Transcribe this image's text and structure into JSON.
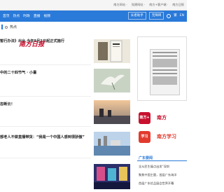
{
  "topbar": {
    "links": [
      "南方网站 ·",
      "党建网站 ·",
      "南方+客户端 ·",
      "南方日报"
    ]
  },
  "navbar": {
    "items": [
      "首页",
      "热点",
      "时政",
      "直播",
      "视频"
    ],
    "buttons": [
      "长者助手",
      "无障碍"
    ],
    "lang": [
      "繁",
      "EN"
    ]
  },
  "section": {
    "title": "热点"
  },
  "news": [
    {
      "title": "暂行办法》出台 今年9月1日起正式施行"
    },
    {
      "title": "中的二十四节气 · 小暑"
    },
    {
      "title": "忽断云！"
    },
    {
      "title": "部老人不做直播带货：“我是一个中国人感到很骄傲”"
    },
    {
      "title": ""
    }
  ],
  "side": {
    "logo": "南方日报",
    "apps": [
      {
        "icon": "南方+",
        "label": "南方"
      },
      {
        "icon": "学习",
        "label": "南方学习"
      }
    ]
  },
  "guangdong": {
    "title": "广东要闻",
    "items": [
      "全从民生痛点出发“深圳",
      "聚焦中国主题，首届广东海洋",
      "首届广东优品展会世界开幕"
    ]
  },
  "colors": {
    "brand_blue": "#2a7ad9",
    "brand_red": "#c8102e"
  }
}
